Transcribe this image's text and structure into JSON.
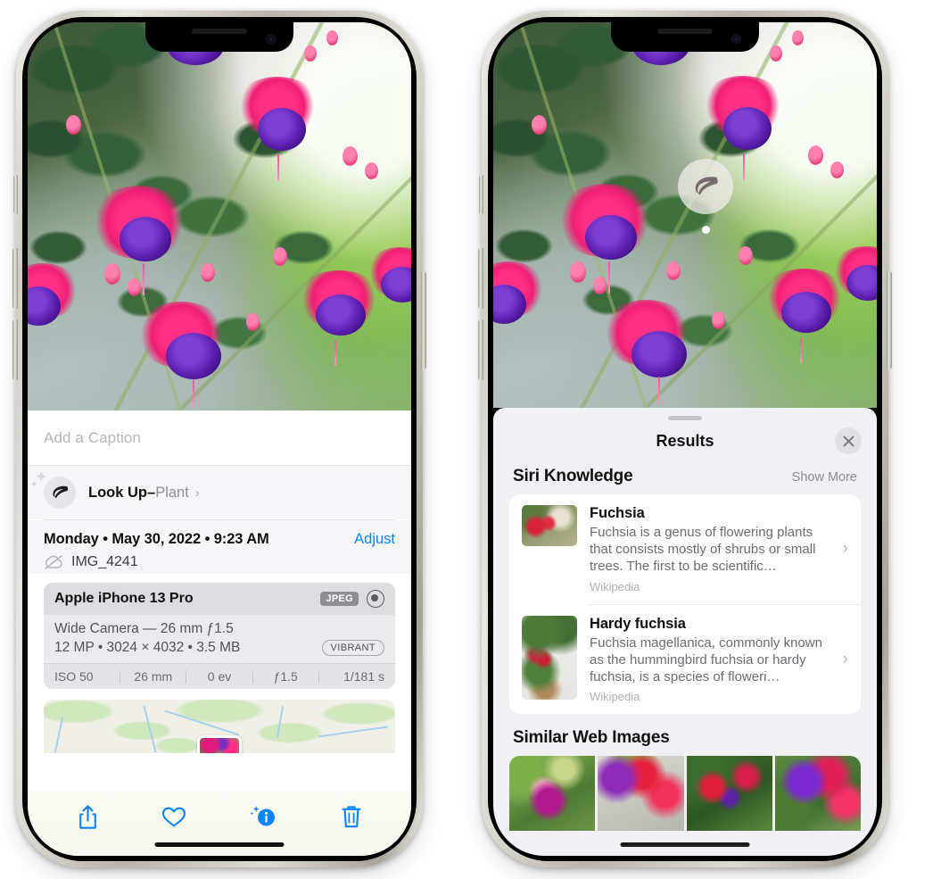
{
  "left_phone": {
    "photo_alt": "fuchsia-flowers-photo",
    "caption_placeholder": "Add a Caption",
    "lookup": {
      "icon": "leaf-icon",
      "sparkle_icon": "sparkles-icon",
      "label": "Look Up",
      "dash": "–",
      "value": "Plant",
      "chevron": "›"
    },
    "metadata": {
      "date": "Monday • May 30, 2022 • 9:23 AM",
      "adjust_label": "Adjust",
      "cloud_icon": "cloud-slash-icon",
      "filename": "IMG_4241"
    },
    "exif": {
      "device": "Apple iPhone 13 Pro",
      "format_badge": "JPEG",
      "lens_icon": "lens-icon",
      "lens_line": "Wide Camera — 26 mm ƒ1.5",
      "size_line": "12 MP • 3024 × 4032 • 3.5 MB",
      "style_badge": "VIBRANT",
      "stats": [
        "ISO 50",
        "26 mm",
        "0 ev",
        "ƒ1.5",
        "1/181 s"
      ]
    },
    "map_alt": "photo-location-map",
    "toolbar": [
      {
        "name": "share-icon",
        "label": "Share"
      },
      {
        "name": "heart-icon",
        "label": "Favorite"
      },
      {
        "name": "info-icon",
        "label": "Info"
      },
      {
        "name": "trash-icon",
        "label": "Delete"
      }
    ]
  },
  "right_phone": {
    "photo_alt": "fuchsia-flowers-photo",
    "leaf_badge_icon": "leaf-icon",
    "results": {
      "title": "Results",
      "close_icon": "close-icon",
      "siri_knowledge": {
        "title": "Siri Knowledge",
        "show_more": "Show More",
        "items": [
          {
            "title": "Fuchsia",
            "description": "Fuchsia is a genus of flowering plants that consists mostly of shrubs or small trees. The first to be scientific…",
            "source": "Wikipedia",
            "thumb": "fuchsia-red-flowers-thumb",
            "chevron": "›"
          },
          {
            "title": "Hardy fuchsia",
            "description": "Fuchsia magellanica, commonly known as the hummingbird fuchsia or hardy fuchsia, is a species of floweri…",
            "source": "Wikipedia",
            "thumb": "hardy-fuchsia-specimen-thumb",
            "chevron": "›"
          }
        ]
      },
      "similar_web_images": {
        "title": "Similar Web Images",
        "items": [
          "web-image-1",
          "web-image-2",
          "web-image-3",
          "web-image-4"
        ]
      }
    }
  },
  "colors": {
    "accent": "#0a84ff",
    "panel_bg": "#f1f1f5",
    "card_bg": "#ffffff",
    "secondary_text": "#8e8e93"
  }
}
